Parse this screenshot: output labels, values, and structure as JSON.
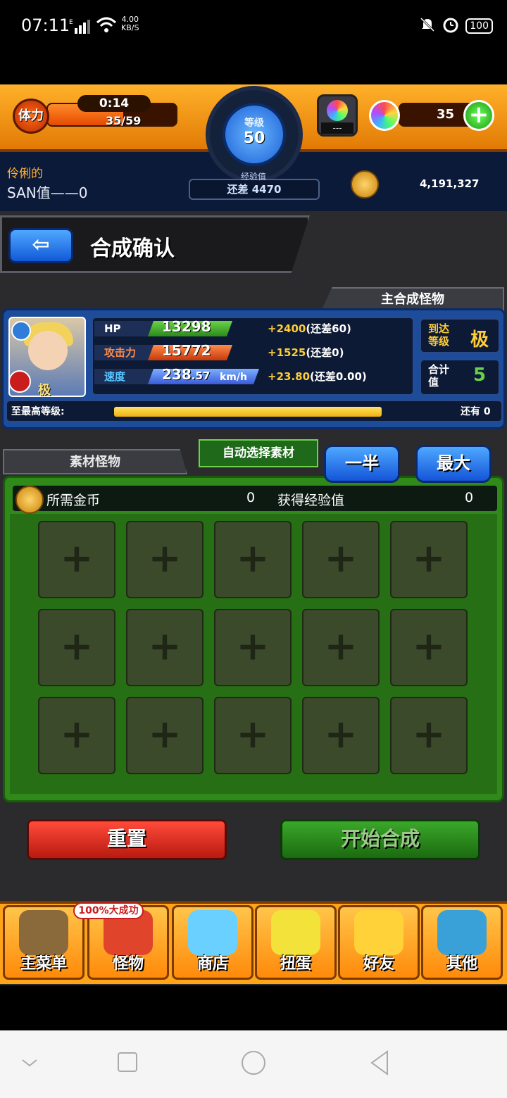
{
  "status_bar": {
    "time": "07:11",
    "net_type": "E",
    "speed_value": "4.00",
    "speed_unit": "KB/S",
    "battery": "100"
  },
  "header": {
    "stamina_label": "体力",
    "stamina_timer": "0:14",
    "stamina_count": "35/59",
    "stamina_fraction": 0.59,
    "level_label": "等级",
    "level_value": "50",
    "exp_label": "经验值",
    "exp_remaining": "还差 4470",
    "stone_value": "---",
    "gem_count": "35",
    "gem_plus": "+",
    "user_name_line1": "伶俐的",
    "user_name_line2": "SAN值——0",
    "coins": "4,191,327"
  },
  "title_bar": {
    "back_icon": "back-arrow-icon",
    "title": "合成确认"
  },
  "main_monster": {
    "tab_label": "主合成怪物",
    "rank_badge": "极",
    "stats": {
      "hp_label": "HP",
      "hp_value": "13298",
      "hp_bonus": "+2400",
      "hp_rest": "(还差60)",
      "atk_label": "攻击力",
      "atk_value": "15772",
      "atk_bonus": "+1525",
      "atk_rest": "(还差0)",
      "spd_label": "速度",
      "spd_value": "238",
      "spd_decimal": ".57",
      "spd_unit": "km/h",
      "spd_bonus": "+23.80",
      "spd_rest": "(还差0.00)"
    },
    "reach_level_label": "到达等级",
    "reach_level_value": "极",
    "total_label": "合计值",
    "total_value": "5",
    "max_level_label": "至最高等级:",
    "max_level_rest": "还有 0",
    "max_level_progress": 1.0
  },
  "material": {
    "tab_material": "素材怪物",
    "tab_auto": "自动选择素材",
    "btn_half": "一半",
    "btn_max": "最大",
    "cost_label": "所需金币",
    "cost_value": "0",
    "exp_gain_label": "获得经验值",
    "exp_gain_value": "0",
    "slot_symbol": "+",
    "slot_count": 15
  },
  "actions": {
    "reset": "重置",
    "start": "开始合成"
  },
  "bottom_nav": {
    "badge": "100%大成功",
    "items": [
      {
        "label": "主菜单",
        "icon": "main-menu-gate-icon"
      },
      {
        "label": "怪物",
        "icon": "monster-icon"
      },
      {
        "label": "商店",
        "icon": "shop-orb-icon"
      },
      {
        "label": "扭蛋",
        "icon": "gacha-egg-icon"
      },
      {
        "label": "好友",
        "icon": "friends-balloon-icon"
      },
      {
        "label": "其他",
        "icon": "other-question-icon"
      }
    ]
  },
  "colors": {
    "header_orange": "#ffb12a",
    "panel_blue": "#1c4c9a",
    "panel_green": "#2f8a1a",
    "button_blue": "#1455d8",
    "reset_red": "#b91a10",
    "start_green": "#1c6a10"
  }
}
